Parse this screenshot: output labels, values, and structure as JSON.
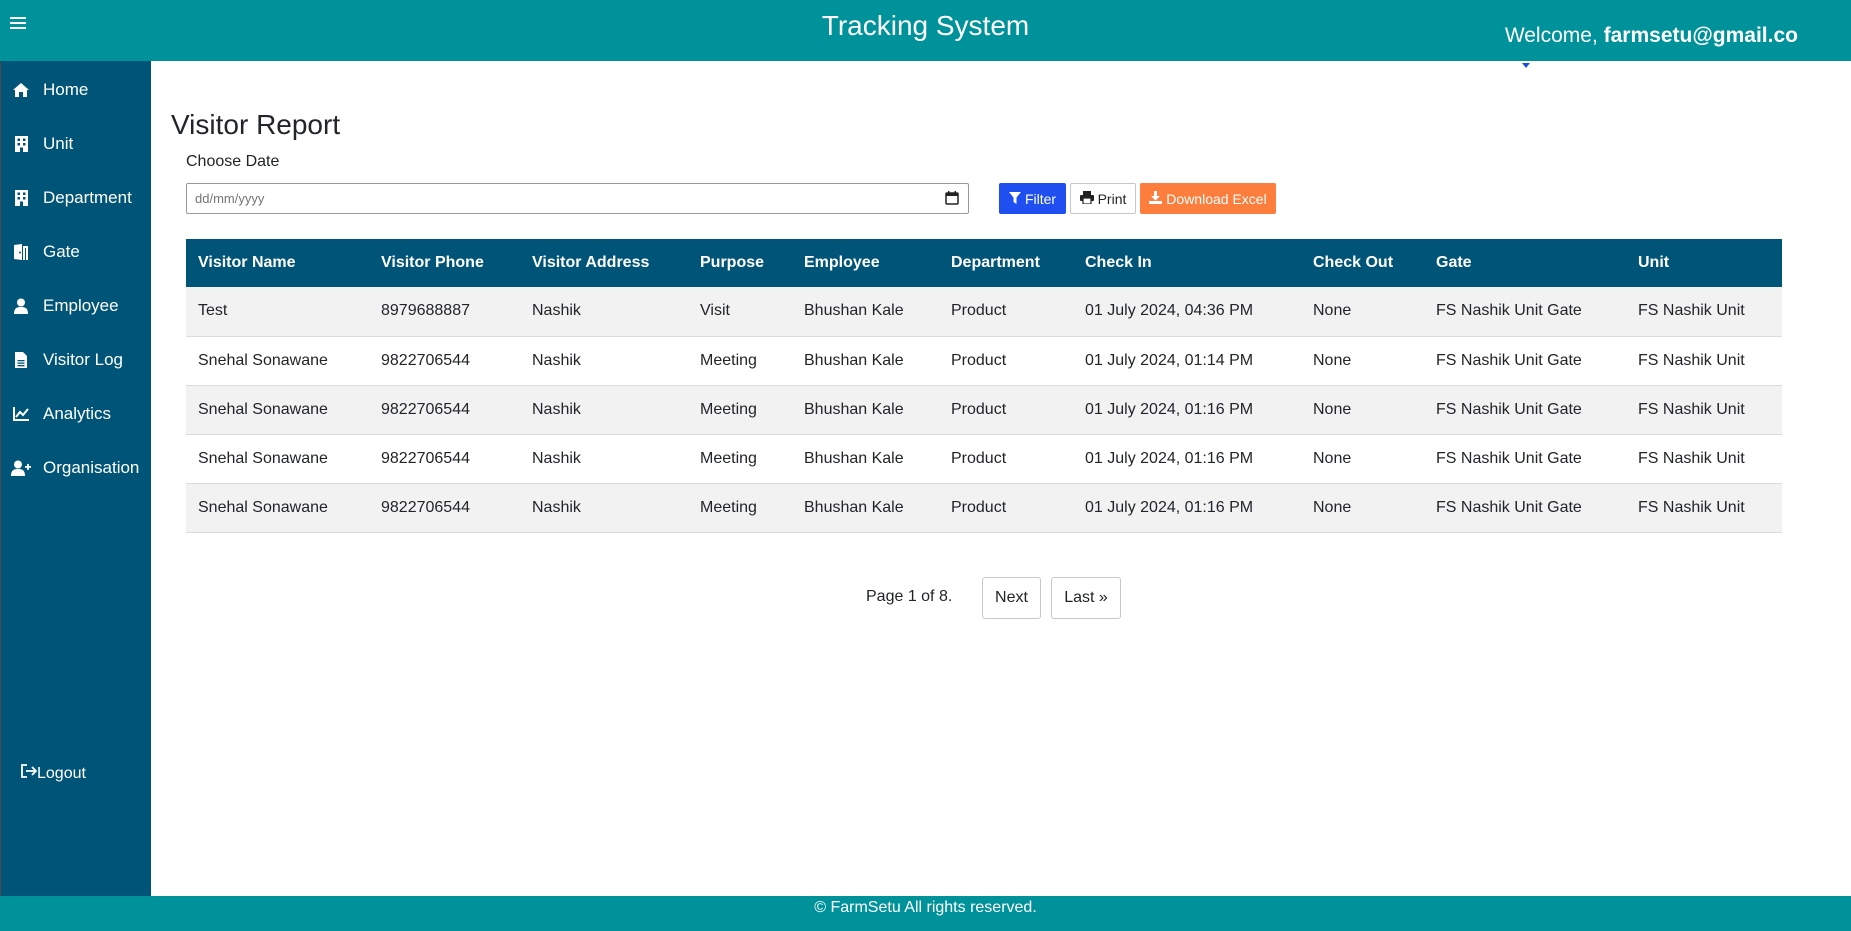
{
  "header": {
    "title": "Tracking System",
    "welcome_prefix": "Welcome, ",
    "user_email": "farmsetu@gmail.co"
  },
  "sidebar": {
    "items": [
      {
        "label": "Home",
        "icon": "home-icon"
      },
      {
        "label": "Unit",
        "icon": "building-icon"
      },
      {
        "label": "Department",
        "icon": "building-icon"
      },
      {
        "label": "Gate",
        "icon": "door-icon"
      },
      {
        "label": "Employee",
        "icon": "user-icon"
      },
      {
        "label": "Visitor Log",
        "icon": "file-icon"
      },
      {
        "label": "Analytics",
        "icon": "chart-line-icon"
      },
      {
        "label": "Organisation",
        "icon": "user-plus-icon"
      }
    ],
    "logout_label": "Logout"
  },
  "page": {
    "title": "Visitor Report",
    "date_label": "Choose Date",
    "date_placeholder": "dd/mm/yyyy"
  },
  "toolbar": {
    "filter_label": "Filter",
    "print_label": "Print",
    "excel_label": "Download Excel"
  },
  "table": {
    "columns": [
      "Visitor Name",
      "Visitor Phone",
      "Visitor Address",
      "Purpose",
      "Employee",
      "Department",
      "Check In",
      "Check Out",
      "Gate",
      "Unit"
    ],
    "rows": [
      [
        "Test",
        "8979688887",
        "Nashik",
        "Visit",
        "Bhushan Kale",
        "Product",
        "01 July 2024, 04:36 PM",
        "None",
        "FS Nashik Unit Gate",
        "FS Nashik Unit"
      ],
      [
        "Snehal Sonawane",
        "9822706544",
        "Nashik",
        "Meeting",
        "Bhushan Kale",
        "Product",
        "01 July 2024, 01:14 PM",
        "None",
        "FS Nashik Unit Gate",
        "FS Nashik Unit"
      ],
      [
        "Snehal Sonawane",
        "9822706544",
        "Nashik",
        "Meeting",
        "Bhushan Kale",
        "Product",
        "01 July 2024, 01:16 PM",
        "None",
        "FS Nashik Unit Gate",
        "FS Nashik Unit"
      ],
      [
        "Snehal Sonawane",
        "9822706544",
        "Nashik",
        "Meeting",
        "Bhushan Kale",
        "Product",
        "01 July 2024, 01:16 PM",
        "None",
        "FS Nashik Unit Gate",
        "FS Nashik Unit"
      ],
      [
        "Snehal Sonawane",
        "9822706544",
        "Nashik",
        "Meeting",
        "Bhushan Kale",
        "Product",
        "01 July 2024, 01:16 PM",
        "None",
        "FS Nashik Unit Gate",
        "FS Nashik Unit"
      ]
    ]
  },
  "pagination": {
    "info": "Page 1 of 8.",
    "next_label": "Next",
    "last_label": "Last »"
  },
  "footer": {
    "text": "© FarmSetu All rights reserved."
  },
  "colors": {
    "topbar": "#00929a",
    "sidebar": "#005478",
    "table_header": "#005478",
    "filter_button": "#1f4ff0",
    "excel_button": "#fd7e3c"
  }
}
